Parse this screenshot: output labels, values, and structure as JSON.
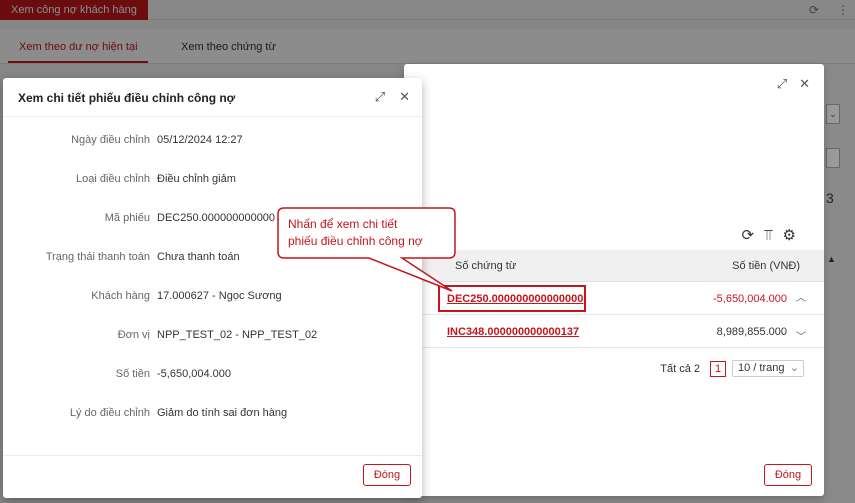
{
  "app": {
    "title_tab": "Xem công nợ khách hàng"
  },
  "base_tabs": [
    {
      "label": "Xem theo dư nợ hiện tại"
    },
    {
      "label": "Xem theo chứng từ"
    }
  ],
  "back_modal": {
    "grid": {
      "columns": [
        "Số chứng từ",
        "Số tiền (VNĐ)"
      ],
      "rows": [
        {
          "doc": "DEC250.000000000000000",
          "amount": "-5,650,004.000"
        },
        {
          "doc": "INC348.000000000000137",
          "amount": "8,989,855.000"
        }
      ]
    },
    "pager": {
      "total_label": "Tất cả 2",
      "current_page": "1",
      "page_size": "10 / trang"
    },
    "close_label": "Đóng",
    "base_right_number": "3"
  },
  "detail_modal": {
    "title": "Xem chi tiết phiếu điều chỉnh công nợ",
    "fields": [
      {
        "label": "Ngày điều chỉnh",
        "value": "05/12/2024 12:27"
      },
      {
        "label": "Loại điều chỉnh",
        "value": "Điều chỉnh giảm"
      },
      {
        "label": "Mã phiếu",
        "value": "DEC250.000000000000"
      },
      {
        "label": "Trạng thái thanh toán",
        "value": "Chưa thanh toán"
      },
      {
        "label": "Khách hàng",
        "value": "17.000627 - Ngọc Sương"
      },
      {
        "label": "Đơn vị",
        "value": "NPP_TEST_02 - NPP_TEST_02"
      },
      {
        "label": "Số tiền",
        "value": "-5,650,004.000"
      },
      {
        "label": "Lý do điều chỉnh",
        "value": "Giảm do tính sai đơn hàng"
      }
    ],
    "close_label": "Đóng"
  },
  "callout": {
    "line1": "Nhấn để xem chi tiết",
    "line2": "phiếu điều chỉnh công nợ"
  },
  "colors": {
    "brand": "#c4161c"
  }
}
